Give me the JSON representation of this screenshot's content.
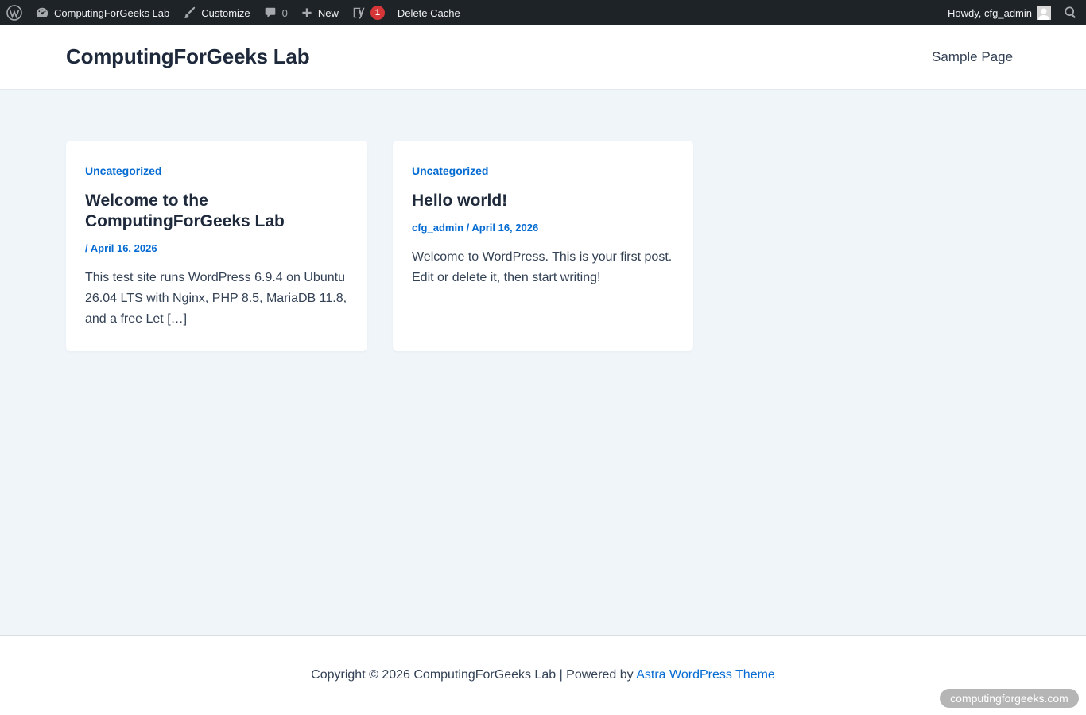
{
  "adminbar": {
    "site_name": "ComputingForGeeks Lab",
    "customize": "Customize",
    "comments_count": "0",
    "new_label": "New",
    "seo_badge": "1",
    "delete_cache": "Delete Cache",
    "howdy": "Howdy, cfg_admin"
  },
  "header": {
    "site_title": "ComputingForGeeks Lab",
    "nav": [
      "Sample Page"
    ]
  },
  "posts": [
    {
      "category": "Uncategorized",
      "title": "Welcome to the ComputingForGeeks Lab",
      "author": "",
      "date": "April 16, 2026",
      "excerpt": "This test site runs WordPress 6.9.4 on Ubuntu 26.04 LTS with Nginx, PHP 8.5, MariaDB 11.8, and a free Let […]"
    },
    {
      "category": "Uncategorized",
      "title": "Hello world!",
      "author": "cfg_admin",
      "date": "April 16, 2026",
      "excerpt": "Welcome to WordPress. This is your first post. Edit or delete it, then start writing!"
    }
  ],
  "footer": {
    "copyright": "Copyright © 2026 ComputingForGeeks Lab | Powered by ",
    "theme_link": "Astra WordPress Theme"
  },
  "watermark": "computingforgeeks.com",
  "colors": {
    "adminbar_bg": "#1d2327",
    "accent": "#046bd2",
    "page_bg": "#f0f5fa",
    "badge": "#d63638"
  }
}
